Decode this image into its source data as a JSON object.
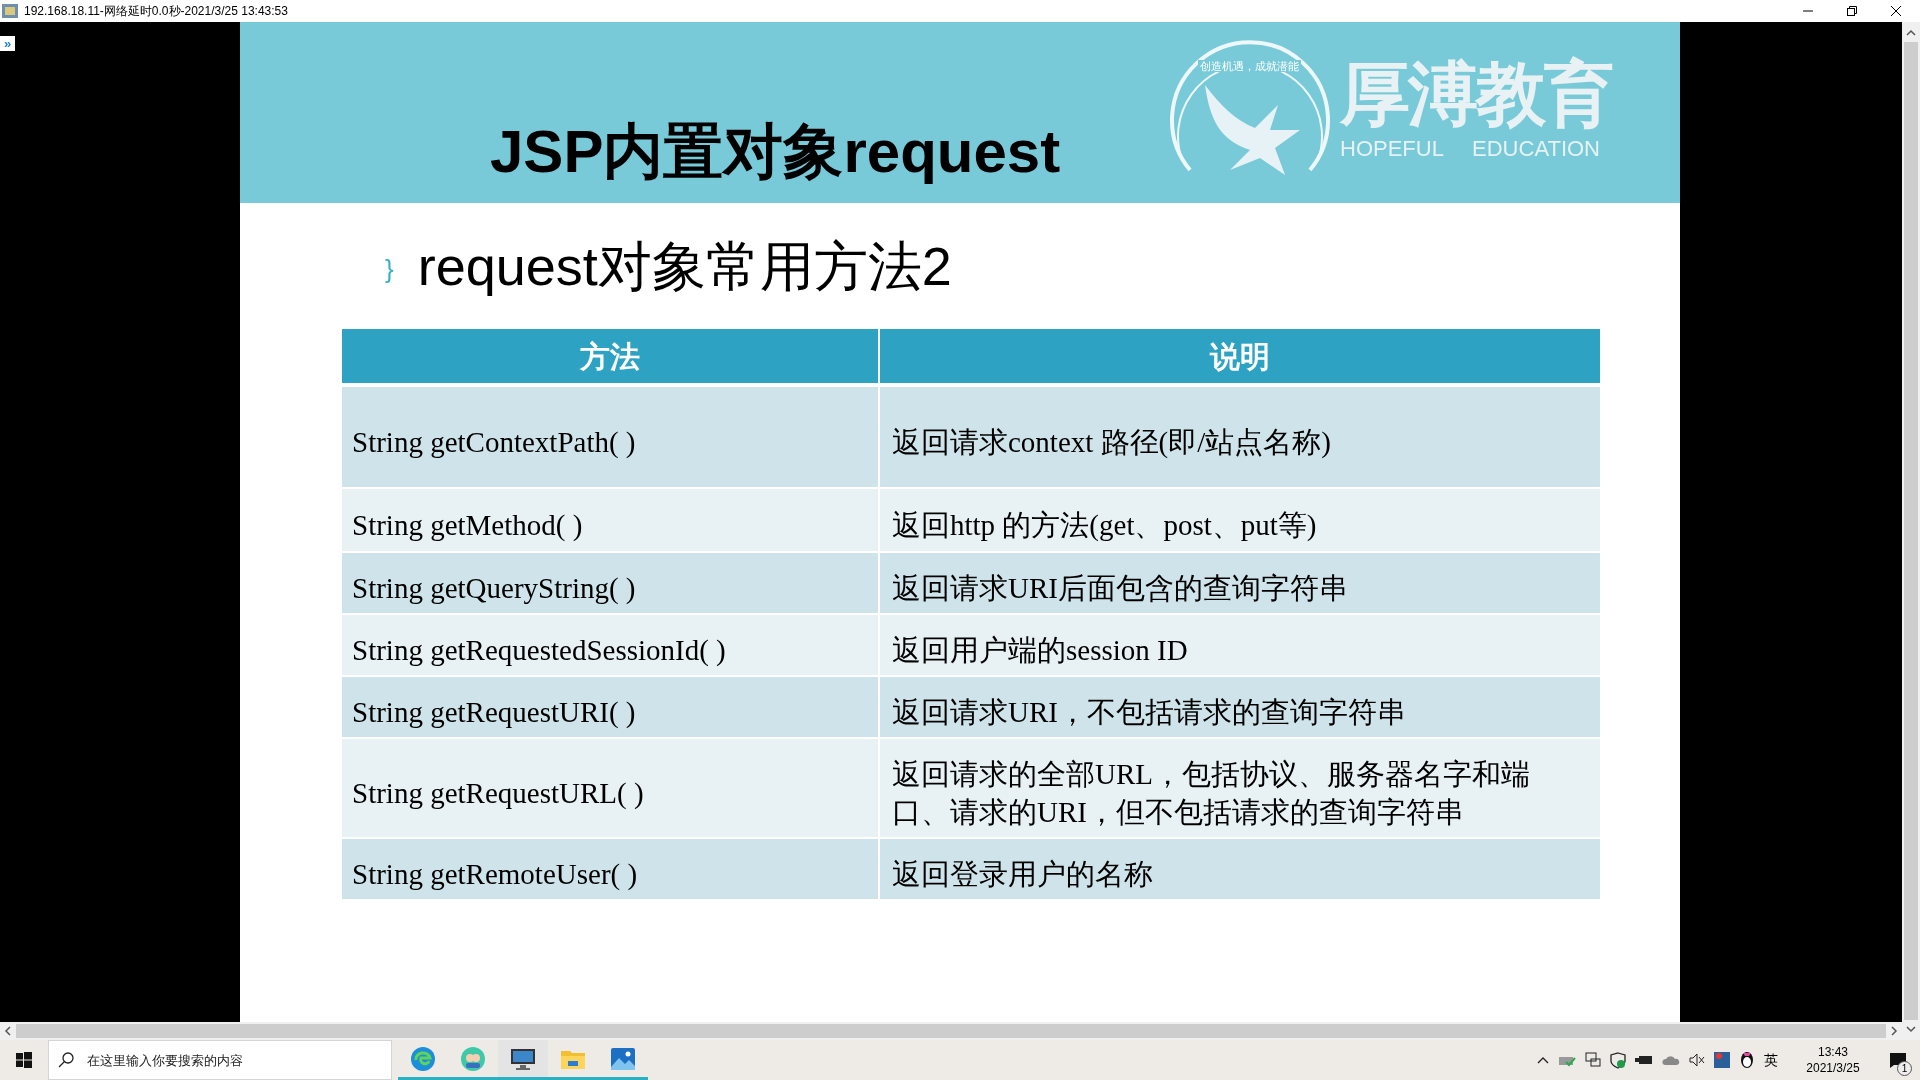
{
  "window": {
    "title": "192.168.18.11-网络延时0.0秒-2021/3/25 13:43:53",
    "side_toggle": "»"
  },
  "slide": {
    "title": "JSP内置对象request",
    "logo": {
      "slogan": "创造机遇，成就潜能",
      "name": "厚溥教育",
      "english_1": "HOPEFUL",
      "english_2": "EDUCATION"
    },
    "bullet": "}",
    "subtitle": "request对象常用方法2",
    "table": {
      "columns": [
        "方法",
        "说明"
      ],
      "rows": [
        [
          "String getContextPath( )",
          "返回请求context 路径(即/站点名称)"
        ],
        [
          "String getMethod( )",
          "返回http 的方法(get、post、put等)"
        ],
        [
          "String getQueryString( )",
          "返回请求URI后面包含的查询字符串"
        ],
        [
          "String getRequestedSessionId( )",
          "返回用户端的session ID"
        ],
        [
          "String getRequestURI( )",
          "返回请求URI，不包括请求的查询字符串"
        ],
        [
          "String getRequestURL( )",
          "返回请求的全部URL，包括协议、服务器名字和端口、请求的URI，但不包括请求的查询字符串"
        ],
        [
          "String getRemoteUser( )",
          "返回登录用户的名称"
        ]
      ]
    }
  },
  "taskbar": {
    "search": {
      "placeholder": "在这里输入你要搜索的内容"
    },
    "input_method": "英",
    "time": "13:43",
    "date": "2021/3/25",
    "notification_count": "1"
  }
}
